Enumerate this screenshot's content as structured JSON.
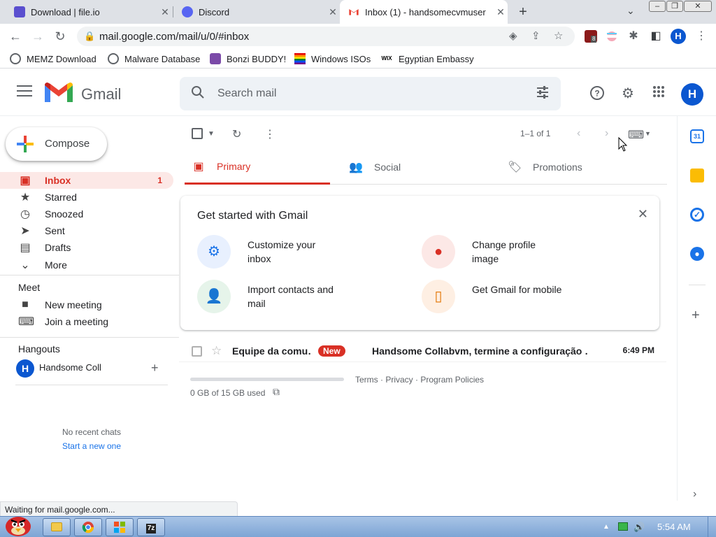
{
  "browser": {
    "tabs": [
      {
        "title": "Download | file.io",
        "active": false
      },
      {
        "title": "Discord",
        "active": false
      },
      {
        "title": "Inbox (1) - handsomecvmuser",
        "active": true
      }
    ],
    "new_tab": "+",
    "url": "mail.google.com/mail/u/0/#inbox",
    "profile_initial": "H",
    "extension_badge": "8",
    "bookmarks": [
      {
        "label": "MEMZ Download",
        "icon": "globe-icon"
      },
      {
        "label": "Malware Database",
        "icon": "globe-icon"
      },
      {
        "label": "Bonzi BUDDY!",
        "icon": "bonzi-icon"
      },
      {
        "label": "Windows ISOs",
        "icon": "rainbow-flag-icon"
      },
      {
        "label": "Egyptian Embassy",
        "icon": "wix-icon",
        "icon_text": "WIX"
      }
    ]
  },
  "gmail": {
    "logo_text": "Gmail",
    "search_placeholder": "Search mail",
    "account_initial": "H",
    "compose_label": "Compose",
    "nav": [
      {
        "label": "Inbox",
        "count": "1",
        "icon": "inbox-icon",
        "active": true
      },
      {
        "label": "Starred",
        "count": "",
        "icon": "star-icon",
        "active": false
      },
      {
        "label": "Snoozed",
        "count": "",
        "icon": "clock-icon",
        "active": false
      },
      {
        "label": "Sent",
        "count": "",
        "icon": "send-icon",
        "active": false
      },
      {
        "label": "Drafts",
        "count": "",
        "icon": "draft-icon",
        "active": false
      },
      {
        "label": "More",
        "count": "",
        "icon": "chevron-down-icon",
        "active": false
      }
    ],
    "meet": {
      "title": "Meet",
      "items": [
        {
          "label": "New meeting",
          "icon": "video-icon"
        },
        {
          "label": "Join a meeting",
          "icon": "keyboard-icon"
        }
      ]
    },
    "hangouts": {
      "title": "Hangouts",
      "user_name": "Handsome Coll",
      "user_initial": "H",
      "no_chats": "No recent chats",
      "start_new": "Start a new one"
    },
    "pager": "1–1 of 1",
    "inbox_tabs": [
      {
        "label": "Primary",
        "icon": "inbox-icon",
        "active": true
      },
      {
        "label": "Social",
        "icon": "people-icon",
        "active": false
      },
      {
        "label": "Promotions",
        "icon": "tag-icon",
        "active": false
      }
    ],
    "get_started": {
      "title": "Get started with Gmail",
      "items": [
        {
          "label": "Customize your inbox",
          "icon": "gear-icon",
          "color": "#1a73e8",
          "bg": "#e8f0fe"
        },
        {
          "label": "Change profile image",
          "icon": "account-icon",
          "color": "#d93025",
          "bg": "#fce8e6"
        },
        {
          "label": "Import contacts and mail",
          "icon": "person-add-icon",
          "color": "#188038",
          "bg": "#e6f4ea"
        },
        {
          "label": "Get Gmail for mobile",
          "icon": "phone-icon",
          "color": "#e37400",
          "bg": "#feefe3"
        }
      ]
    },
    "emails": [
      {
        "sender": "Equipe da comu…",
        "badge": "New",
        "subject": "Handsome Collabvm, termine a configuração …",
        "time": "6:49 PM"
      }
    ],
    "storage": {
      "text": "0 GB of 15 GB used",
      "fraction": 0.0
    },
    "footer": {
      "terms": "Terms",
      "privacy": "Privacy",
      "policies": "Program Policies",
      "separator": " · "
    },
    "side_panel": [
      {
        "icon": "calendar-icon",
        "color": "#1a73e8",
        "text": "31"
      },
      {
        "icon": "keep-icon",
        "color": "#fbbc04",
        "text": ""
      },
      {
        "icon": "tasks-icon",
        "color": "#1a73e8",
        "text": ""
      },
      {
        "icon": "contacts-icon",
        "color": "#1a73e8",
        "text": ""
      }
    ]
  },
  "status_text": "Waiting for mail.google.com...",
  "taskbar": {
    "clock": "5:54 AM",
    "apps": [
      {
        "name": "explorer-icon",
        "text": ""
      },
      {
        "name": "chrome-icon",
        "text": ""
      },
      {
        "name": "windows-icon",
        "text": ""
      },
      {
        "name": "7zip-icon",
        "text": "7z"
      }
    ]
  }
}
